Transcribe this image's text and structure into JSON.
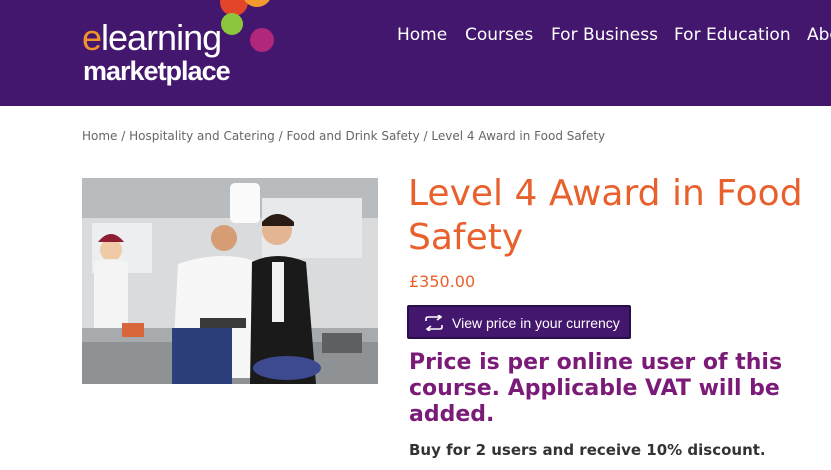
{
  "header": {
    "logo": {
      "line1_first": "e",
      "line1_rest": "learning",
      "line2": "marketplace"
    },
    "nav": [
      {
        "label": "Home"
      },
      {
        "label": "Courses"
      },
      {
        "label": "For Business"
      },
      {
        "label": "For Education"
      },
      {
        "label": "About"
      }
    ]
  },
  "breadcrumb": {
    "items": [
      "Home",
      "Hospitality and Catering",
      "Food and Drink Safety"
    ],
    "separator": "/",
    "current": "Level 4 Award in Food Safety"
  },
  "product": {
    "image_icon": "kitchen-chefs-photo",
    "title": "Level 4 Award in Food Safety",
    "price": "£350.00",
    "currency_button": {
      "icon": "exchange-arrows-icon",
      "label": "View price in your currency"
    },
    "price_note": "Price is per online user of this course. Applicable VAT will be added.",
    "discount_text": "Buy for 2 users and receive 10% discount."
  },
  "colors": {
    "header_bg": "#44176e",
    "title_orange": "#e8612c",
    "note_purple": "#7a1b78",
    "logo_e_orange": "#f0932b"
  }
}
